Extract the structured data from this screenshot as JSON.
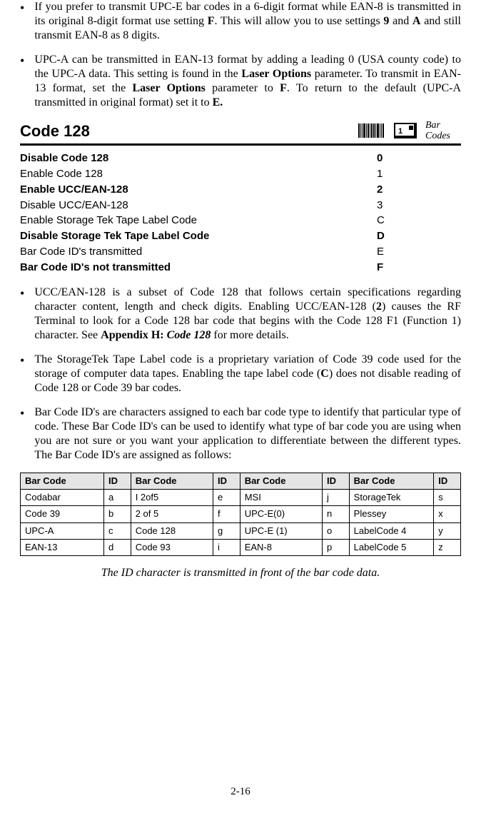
{
  "top_bullets": [
    {
      "segments": [
        {
          "t": "If you prefer to transmit UPC-E bar codes in a 6-digit format while EAN-8 is transmitted in its original 8-digit format use setting "
        },
        {
          "t": "F",
          "cls": "b"
        },
        {
          "t": ".  This will allow you to use settings "
        },
        {
          "t": "9",
          "cls": "b"
        },
        {
          "t": " and "
        },
        {
          "t": "A",
          "cls": "b"
        },
        {
          "t": " and still transmit EAN-8 as 8 digits."
        }
      ]
    },
    {
      "segments": [
        {
          "t": "UPC-A can be transmitted in EAN-13 format by adding a leading 0 (USA county code) to the UPC-A data.  This setting is found in the "
        },
        {
          "t": "Laser Options",
          "cls": "b"
        },
        {
          "t": " parameter.  To transmit in EAN-13 format, set the "
        },
        {
          "t": "Laser Options",
          "cls": "b"
        },
        {
          "t": " parameter to "
        },
        {
          "t": "F",
          "cls": "b"
        },
        {
          "t": ".  To return to the default (UPC-A transmitted in original format) set it to "
        },
        {
          "t": "E.",
          "cls": "b"
        }
      ]
    }
  ],
  "section": {
    "title": "Code 128",
    "icon_label_line1": "Bar",
    "icon_label_line2": "Codes"
  },
  "settings": [
    {
      "label": "Disable Code 128",
      "value": "0",
      "bold": true
    },
    {
      "label": "Enable Code 128",
      "value": "1",
      "bold": false
    },
    {
      "label": "Enable UCC/EAN-128",
      "value": "2",
      "bold": true
    },
    {
      "label": "Disable UCC/EAN-128",
      "value": "3",
      "bold": false
    },
    {
      "label": "Enable Storage Tek Tape Label Code",
      "value": "C",
      "bold": false
    },
    {
      "label": "Disable Storage Tek Tape Label Code",
      "value": "D",
      "bold": true
    },
    {
      "label": "Bar Code ID's transmitted",
      "value": "E",
      "bold": false
    },
    {
      "label": "Bar Code ID's not transmitted",
      "value": "F",
      "bold": true
    }
  ],
  "mid_bullets": [
    {
      "segments": [
        {
          "t": "UCC/EAN-128 is a subset of Code 128 that follows certain specifications regarding character content, length and check digits.  Enabling UCC/EAN-128 ("
        },
        {
          "t": "2",
          "cls": "b"
        },
        {
          "t": ") causes the RF Terminal to look for a Code 128 bar code that begins with the Code 128 F1 (Function 1) character.  See "
        },
        {
          "t": "Appendix H: ",
          "cls": "b"
        },
        {
          "t": "Code 128",
          "cls": "bi"
        },
        {
          "t": " for more details."
        }
      ]
    },
    {
      "segments": [
        {
          "t": "The StorageTek Tape Label code is a proprietary variation of Code 39 code used for the storage of computer data tapes. Enabling the tape label code ("
        },
        {
          "t": "C",
          "cls": "b"
        },
        {
          "t": ") does not disable reading of Code 128 or Code 39 bar codes."
        }
      ]
    },
    {
      "segments": [
        {
          "t": "Bar Code ID's are characters assigned to each bar code type to identify that particular type of code. These Bar Code ID's can be used to identify what type of bar code you are using when you are not sure or you want your application to differentiate between the different types. The Bar Code ID's are assigned as follows:"
        }
      ]
    }
  ],
  "id_table": {
    "headers": [
      "Bar Code",
      "ID",
      "Bar Code",
      "ID",
      "Bar Code",
      "ID",
      "Bar Code",
      "ID"
    ],
    "rows": [
      [
        "Codabar",
        "a",
        "I 2of5",
        "e",
        "MSI",
        "j",
        "StorageTek",
        "s"
      ],
      [
        "Code 39",
        "b",
        "2 of 5",
        "f",
        "UPC-E(0)",
        "n",
        "Plessey",
        "x"
      ],
      [
        "UPC-A",
        "c",
        "Code 128",
        "g",
        "UPC-E (1)",
        "o",
        "LabelCode 4",
        "y"
      ],
      [
        "EAN-13",
        "d",
        "Code 93",
        "i",
        "EAN-8",
        "p",
        "LabelCode 5",
        "z"
      ]
    ]
  },
  "footer_note": "The ID character is transmitted in front of the bar code data.",
  "page_number": "2-16"
}
